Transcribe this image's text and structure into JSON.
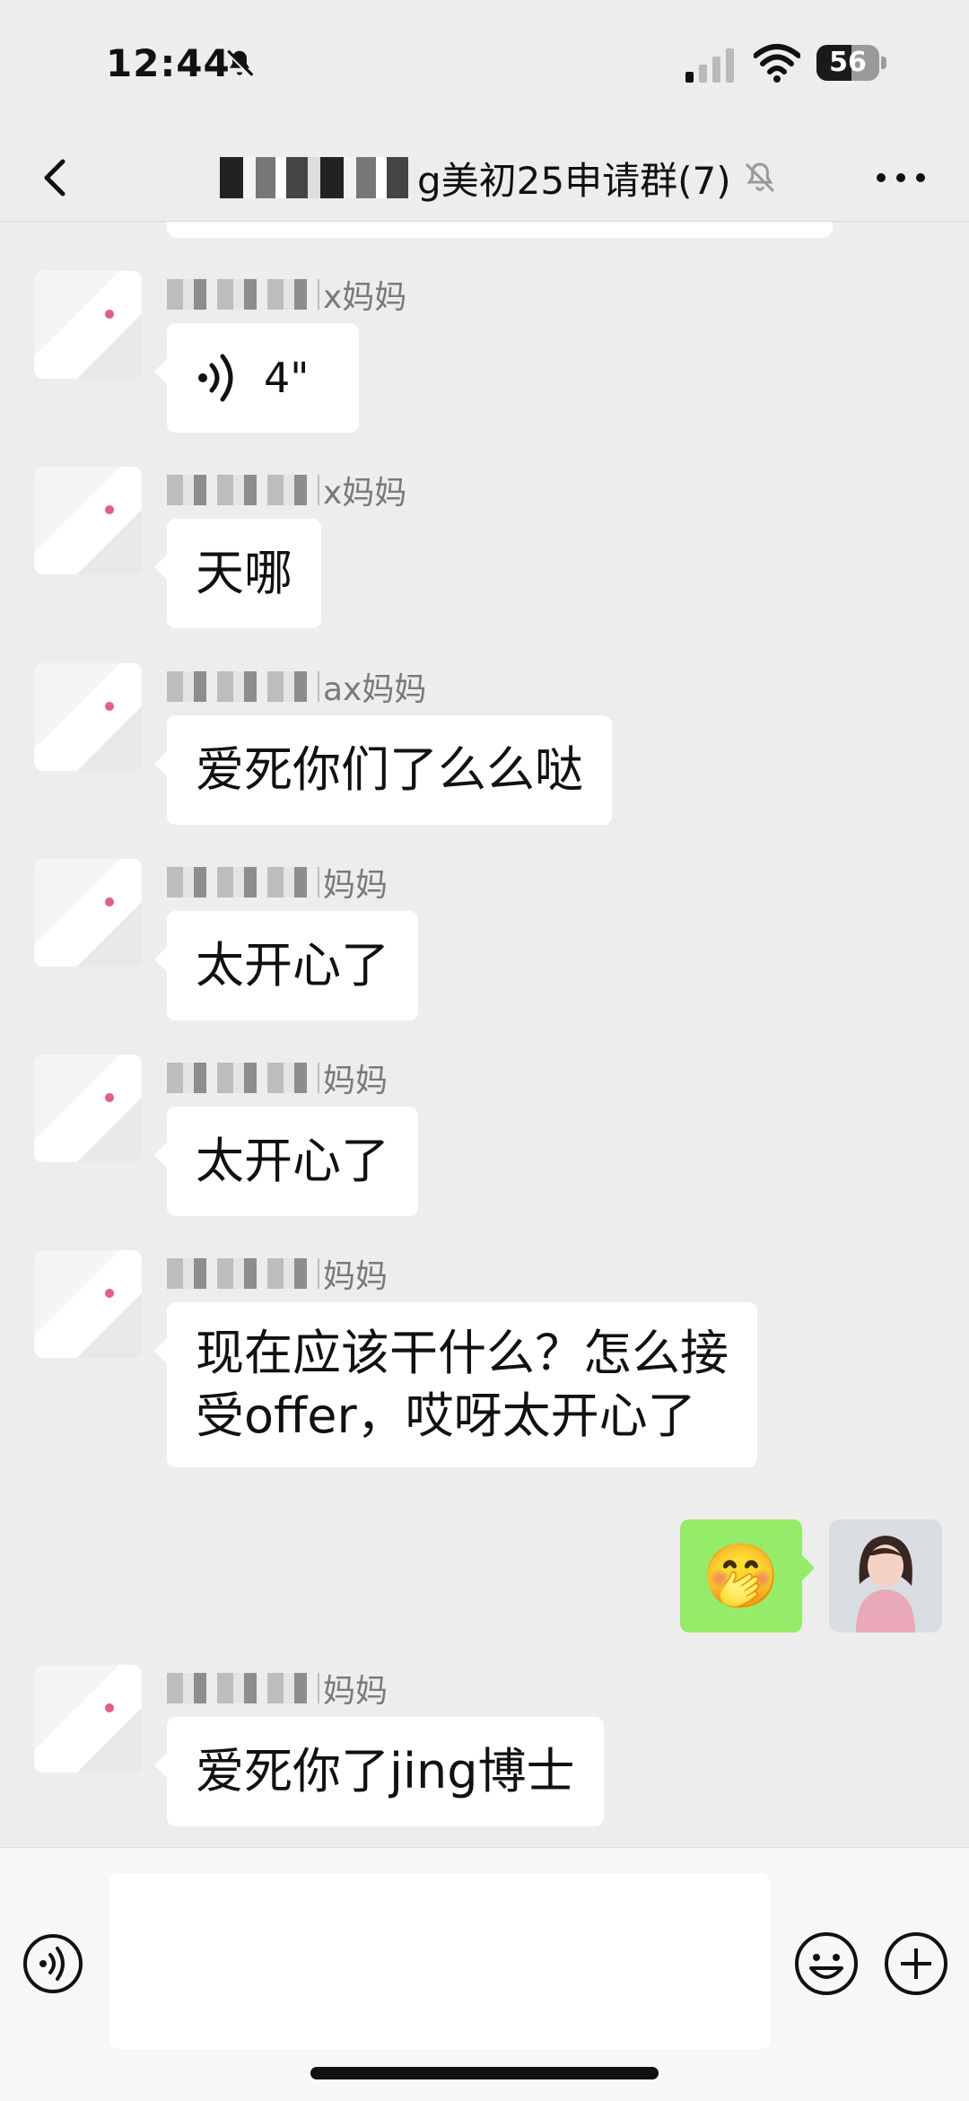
{
  "status_bar": {
    "time": "12:44",
    "battery": "56",
    "battery_level": 0.56,
    "icons": [
      "bell-off-icon",
      "cellular-signal-icon",
      "wifi-icon",
      "battery-icon"
    ]
  },
  "nav": {
    "title": "g美初25申请群(7)",
    "icons": [
      "back-arrow-icon",
      "mute-bell-icon",
      "more-dots-icon"
    ]
  },
  "messages": [
    {
      "sender_suffix": "x妈妈",
      "type": "voice",
      "duration": "4\""
    },
    {
      "sender_suffix": "x妈妈",
      "text": "天哪"
    },
    {
      "sender_suffix": "ax妈妈",
      "text": "爱死你们了么么哒"
    },
    {
      "sender_suffix": "妈妈",
      "text": "太开心了"
    },
    {
      "sender_suffix": "妈妈",
      "text": "太开心了"
    },
    {
      "sender_suffix": "妈妈",
      "text_line1": "现在应该干什么？怎么接",
      "text_line2": "受offer，哎呀太开心了"
    },
    {
      "self": true,
      "type": "emoji",
      "emoji": "🤭"
    },
    {
      "sender_suffix": "妈妈",
      "text": "爱死你了jing博士"
    }
  ],
  "colors": {
    "background": "#EDEDED",
    "self_bubble": "#95EC69",
    "other_bubble": "#FFFFFF",
    "sender_name": "#7A7A7A"
  },
  "input": {
    "value": "",
    "placeholder": ""
  }
}
